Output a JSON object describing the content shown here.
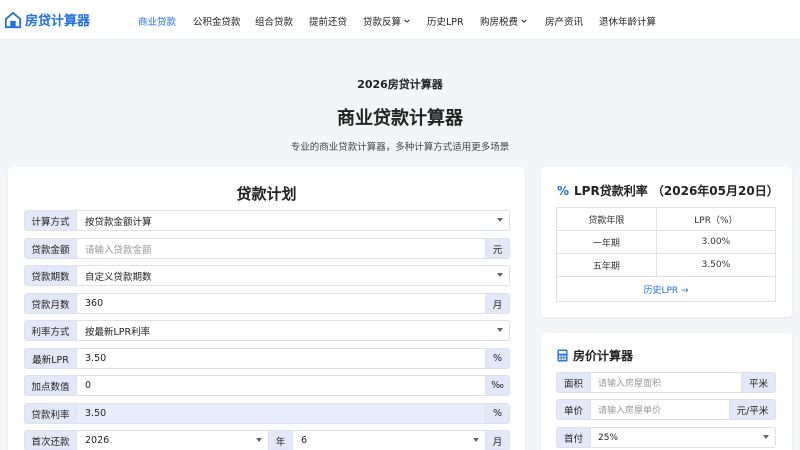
{
  "nav": {
    "logo": "房贷计算器",
    "items": [
      {
        "label": "商业贷款",
        "active": true
      },
      {
        "label": "公积金贷款"
      },
      {
        "label": "组合贷款"
      },
      {
        "label": "提前还贷"
      },
      {
        "label": "贷款反算",
        "dropdown": true
      },
      {
        "label": "历史LPR"
      },
      {
        "label": "购房税费",
        "dropdown": true
      },
      {
        "label": "房产资讯"
      },
      {
        "label": "退休年龄计算"
      }
    ]
  },
  "hero": {
    "subtitle": "2026房贷计算器",
    "title": "商业贷款计算器",
    "description": "专业的商业贷款计算器，多种计算方式适用更多场景"
  },
  "loan": {
    "title": "贷款计划",
    "rows": [
      {
        "label": "计算方式",
        "value": "按贷款金额计算",
        "type": "select"
      },
      {
        "label": "贷款金额",
        "placeholder": "请输入贷款金额",
        "unit": "元"
      },
      {
        "label": "贷款期数",
        "value": "自定义贷款期数",
        "type": "select"
      },
      {
        "label": "贷款月数",
        "value": "360",
        "unit": "月"
      },
      {
        "label": "利率方式",
        "value": "按最新LPR利率",
        "type": "select"
      },
      {
        "label": "最新LPR",
        "value": "3.50",
        "unit": "%"
      },
      {
        "label": "加点数值",
        "value": "0",
        "unit": "‰"
      },
      {
        "label": "贷款利率",
        "value": "3.50",
        "unit": "%",
        "highlight": true
      }
    ],
    "first_payment": {
      "label": "首次还款",
      "year": "2026",
      "year_unit": "年",
      "month": "6",
      "month_unit": "月"
    }
  },
  "lpr": {
    "title": "LPR贷款利率 （2026年05月20日）",
    "headers": [
      "贷款年限",
      "LPR（%）"
    ],
    "rows": [
      [
        "一年期",
        "3.00%"
      ],
      [
        "五年期",
        "3.50%"
      ]
    ],
    "link": "历史LPR →"
  },
  "price": {
    "title": "房价计算器",
    "rows": [
      {
        "label": "面积",
        "placeholder": "请输入房屋面积",
        "unit": "平米"
      },
      {
        "label": "单价",
        "placeholder": "请输入房屋单价",
        "unit": "元/平米"
      },
      {
        "label": "首付",
        "value": "25%",
        "type": "select"
      }
    ]
  }
}
